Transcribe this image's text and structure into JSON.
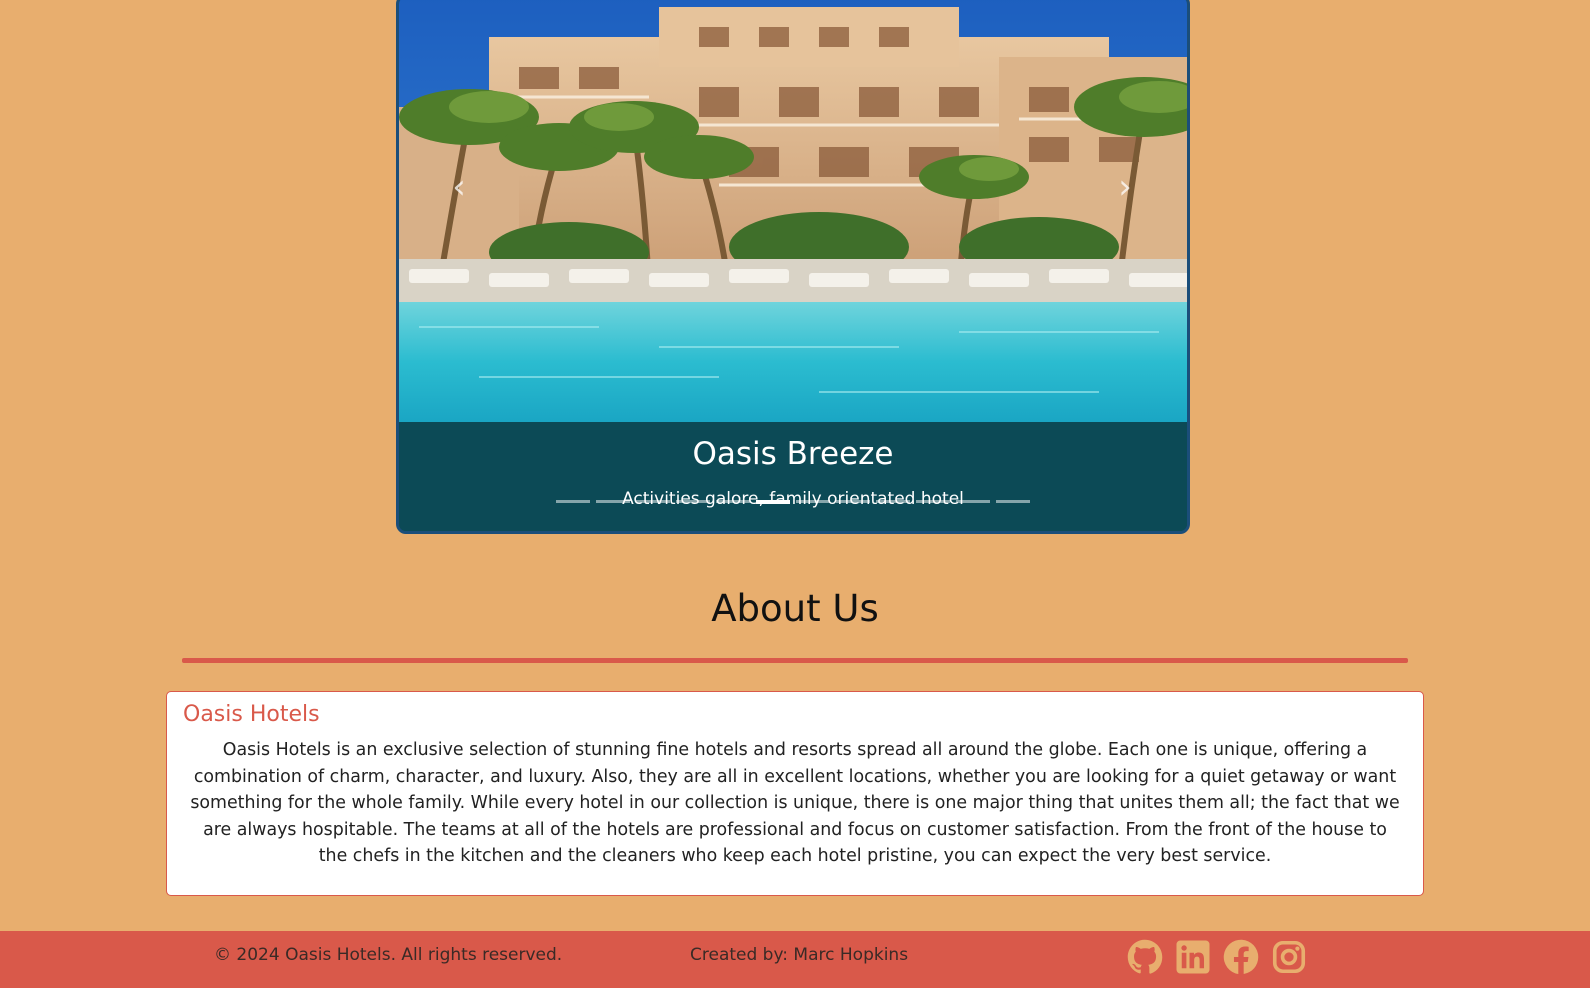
{
  "carousel": {
    "slide_title": "Oasis Breeze",
    "slide_text": "Activities galore, family orientated hotel",
    "indicator_count": 12,
    "active_index": 5,
    "prev_icon": "chevron-left-icon",
    "next_icon": "chevron-right-icon"
  },
  "about": {
    "heading": "About Us",
    "card_title": "Oasis Hotels",
    "card_text": "Oasis Hotels is an exclusive selection of stunning fine hotels and resorts spread all around the globe. Each one is unique, offering a combination of charm, character, and luxury. Also, they are all in excellent locations, whether you are looking for a quiet getaway or want something for the whole family. While every hotel in our collection is unique, there is one major thing that unites them all; the fact that we are always hospitable. The teams at all of the hotels are professional and focus on customer satisfaction. From the front of the house to the chefs in the kitchen and the cleaners who keep each hotel pristine, you can expect the very best service."
  },
  "footer": {
    "copyright": "© 2024 Oasis Hotels. All rights reserved.",
    "credit": "Created by: Marc Hopkins",
    "social": [
      {
        "name": "github-icon"
      },
      {
        "name": "linkedin-icon"
      },
      {
        "name": "facebook-icon"
      },
      {
        "name": "instagram-icon"
      }
    ]
  },
  "colors": {
    "page_background": "#e8ae6e",
    "accent": "#d9594a",
    "caption_background": "#0c4a56",
    "carousel_border": "#1b4e7a",
    "social_icon": "#e8ae6e"
  }
}
